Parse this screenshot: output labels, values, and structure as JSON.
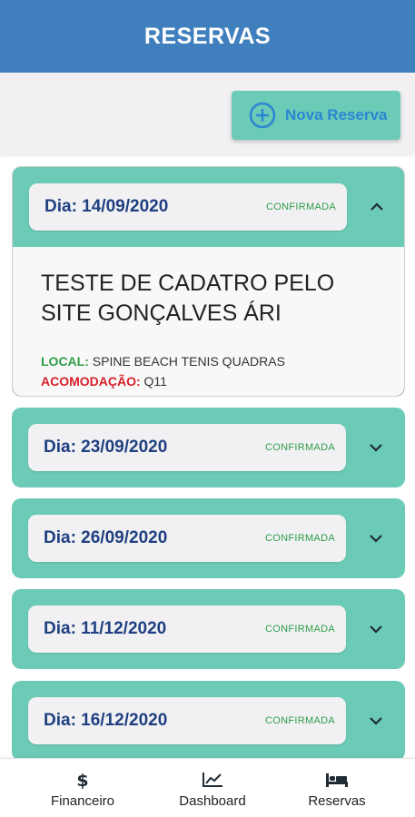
{
  "header": {
    "title": "RESERVAS"
  },
  "toolbar": {
    "new_button_label": "Nova Reserva"
  },
  "colors": {
    "header_bg": "#3f7fbd",
    "card_bg": "#6ccbb6",
    "date_text": "#1f3f80",
    "status_text": "#2e9d4a",
    "local_key": "#2e9d4a",
    "acomodacao_key": "#d6202a",
    "accent_blue": "#2b86d4"
  },
  "reservations": [
    {
      "date_label": "Dia: 14/09/2020",
      "status": "CONFIRMADA",
      "expanded": true,
      "chevron": "chevron-up-icon",
      "title": "TESTE DE CADATRO PELO SITE GONÇALVES ÁRI",
      "local_key": "LOCAL:",
      "local_value": "SPINE BEACH TENIS QUADRAS",
      "acomodacao_key": "ACOMODAÇÃO:",
      "acomodacao_value": "Q11"
    },
    {
      "date_label": "Dia: 23/09/2020",
      "status": "CONFIRMADA",
      "expanded": false,
      "chevron": "chevron-down-icon"
    },
    {
      "date_label": "Dia: 26/09/2020",
      "status": "CONFIRMADA",
      "expanded": false,
      "chevron": "chevron-down-icon"
    },
    {
      "date_label": "Dia: 11/12/2020",
      "status": "CONFIRMADA",
      "expanded": false,
      "chevron": "chevron-down-icon"
    },
    {
      "date_label": "Dia: 16/12/2020",
      "status": "CONFIRMADA",
      "expanded": false,
      "chevron": "chevron-down-icon"
    }
  ],
  "bottom_nav": [
    {
      "label": "Financeiro",
      "icon": "dollar-icon"
    },
    {
      "label": "Dashboard",
      "icon": "chart-line-icon"
    },
    {
      "label": "Reservas",
      "icon": "bed-icon"
    }
  ]
}
